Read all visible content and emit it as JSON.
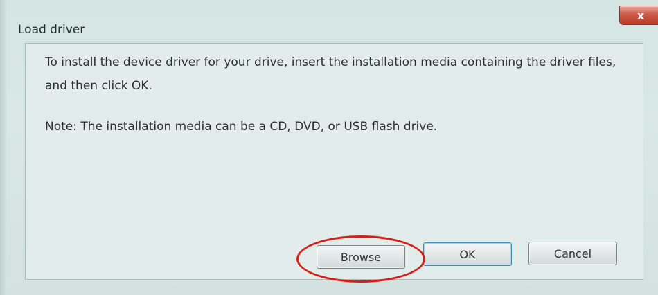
{
  "window": {
    "title": "Load driver",
    "close_symbol": "x"
  },
  "content": {
    "message": "To install the device driver for your drive, insert the installation media containing the driver files, and then click OK.",
    "note": "Note: The installation media can be a CD, DVD, or USB flash drive."
  },
  "buttons": {
    "browse": {
      "accel": "B",
      "rest": "rowse"
    },
    "ok": "OK",
    "cancel": "Cancel"
  },
  "annotation": {
    "highlight_color": "#d91e18",
    "highlight_target": "browse"
  }
}
